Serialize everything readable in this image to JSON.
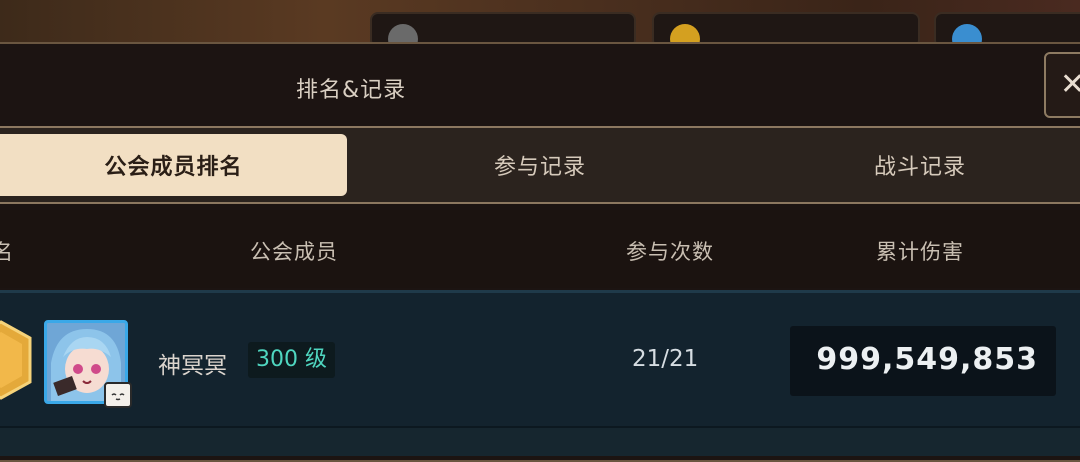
{
  "window": {
    "title": "排名&记录",
    "close_label": "✕"
  },
  "top_resources": [
    {
      "icon": "cup-icon",
      "value": ""
    },
    {
      "icon": "coin-icon",
      "value": ""
    },
    {
      "icon": "gem-icon",
      "value": ""
    }
  ],
  "tabs": [
    {
      "label": "公会成员排名",
      "active": true
    },
    {
      "label": "参与记录",
      "active": false
    },
    {
      "label": "战斗记录",
      "active": false
    }
  ],
  "columns": {
    "rank": "名",
    "member": "公会成员",
    "count": "参与次数",
    "damage": "累计伤害"
  },
  "rows": [
    {
      "name": "神冥冥",
      "level": "300 级",
      "count": "21/21",
      "damage": "999,549,853"
    }
  ],
  "colors": {
    "accent": "#f2dfc3",
    "level": "#4fd6c0",
    "avatar_border": "#3aa8e8"
  }
}
